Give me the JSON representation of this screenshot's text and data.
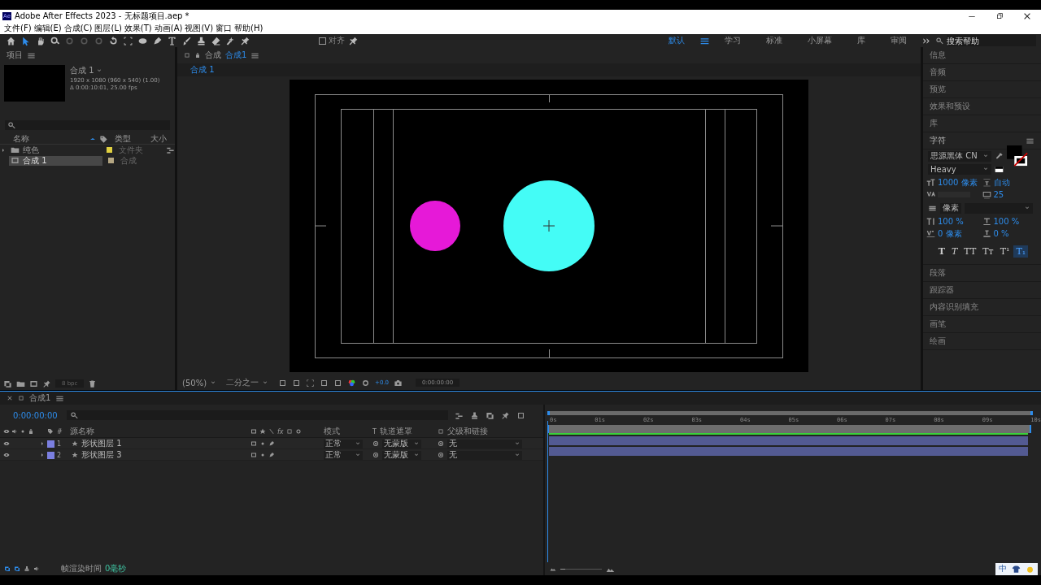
{
  "window": {
    "badge": "Ae",
    "title": "Adobe After Effects 2023 - 无标题项目.aep *"
  },
  "menu": [
    "文件(F)",
    "编辑(E)",
    "合成(C)",
    "图层(L)",
    "效果(T)",
    "动画(A)",
    "视图(V)",
    "窗口",
    "帮助(H)"
  ],
  "tools": [
    {
      "kind": "home",
      "selected": false,
      "disabled": false
    },
    {
      "kind": "select",
      "selected": true,
      "disabled": false
    },
    {
      "kind": "hand",
      "selected": false,
      "disabled": false
    },
    {
      "kind": "zoom",
      "selected": false,
      "disabled": false
    },
    {
      "kind": "orbit",
      "selected": false,
      "disabled": true
    },
    {
      "kind": "orbit",
      "selected": false,
      "disabled": true
    },
    {
      "kind": "orbit",
      "selected": false,
      "disabled": true
    },
    {
      "kind": "rotate",
      "selected": false,
      "disabled": false
    },
    {
      "kind": "marquee",
      "selected": false,
      "disabled": false
    },
    {
      "kind": "ellipse",
      "selected": false,
      "disabled": false
    },
    {
      "kind": "pen",
      "selected": false,
      "disabled": false
    },
    {
      "kind": "text",
      "selected": false,
      "disabled": false
    },
    {
      "kind": "brush",
      "selected": false,
      "disabled": false
    },
    {
      "kind": "stamp",
      "selected": false,
      "disabled": false
    },
    {
      "kind": "eraser",
      "selected": false,
      "disabled": false
    },
    {
      "kind": "roto",
      "selected": false,
      "disabled": false
    },
    {
      "kind": "pin",
      "selected": false,
      "disabled": false
    }
  ],
  "snap": {
    "label": "对齐",
    "checked": false
  },
  "workspaces": [
    {
      "label": "默认",
      "selected": true
    },
    {
      "label": "学习",
      "selected": false
    },
    {
      "label": "标准",
      "selected": false
    },
    {
      "label": "小屏幕",
      "selected": false
    },
    {
      "label": "库",
      "selected": false
    },
    {
      "label": "审阅",
      "selected": false
    }
  ],
  "search": {
    "placeholder": "搜索帮助"
  },
  "project": {
    "title": "项目",
    "comp_name": "合成 1",
    "comp_size": "1920 x 1080  (960 x 540) (1.00)",
    "comp_duration": "Δ 0:00:10:01, 25.00 fps",
    "columns": [
      "名称",
      "类型",
      "大小"
    ],
    "rows": [
      {
        "kind": "folder",
        "name": "纯色",
        "type": "文件夹",
        "color": "#e0d040",
        "selected": false
      },
      {
        "kind": "comp",
        "name": "合成 1",
        "type": "合成",
        "color": "#b4a682",
        "selected": true
      }
    ],
    "bpc": "8 bpc"
  },
  "viewer": {
    "panel": "合成",
    "tab": "合成1",
    "breadcrumb": "合成 1",
    "shapes": [
      {
        "kind": "small",
        "color": "#e619d8"
      },
      {
        "kind": "large",
        "color": "#44fcf6"
      }
    ],
    "zoom": "(50%)",
    "resolution": "二分之一",
    "exposure": "+0.0",
    "timecode": "0:00:00:00"
  },
  "panels_top": [
    "信息",
    "音频",
    "预览",
    "效果和预设",
    "库"
  ],
  "character": {
    "title": "字符",
    "font": "思源黑体 CN",
    "style": "Heavy",
    "metrics": [
      {
        "kind": "size",
        "value": "1000 像素"
      },
      {
        "kind": "leading",
        "value": "自动"
      },
      {
        "kind": "kerning"
      },
      {
        "kind": "tracking",
        "value": "25"
      }
    ],
    "stroke": "像素",
    "scales": [
      {
        "kind": "vscale",
        "value": "100 %"
      },
      {
        "kind": "hscale",
        "value": "100 %"
      },
      {
        "kind": "baseline",
        "value": "0 像素"
      },
      {
        "kind": "tsume",
        "value": "0 %"
      }
    ],
    "styles": [
      {
        "kind": "bold",
        "label": "T",
        "selected": false
      },
      {
        "kind": "italic",
        "label": "T",
        "selected": false
      },
      {
        "kind": "caps",
        "label": "TT",
        "selected": false
      },
      {
        "kind": "smallcaps",
        "label": "Tт",
        "selected": false
      },
      {
        "kind": "super",
        "label": "T¹",
        "selected": false
      },
      {
        "kind": "sub",
        "label": "T₁",
        "selected": true
      }
    ]
  },
  "panels_bottom": [
    "段落",
    "跟踪器",
    "内容识别填充",
    "画笔",
    "绘画"
  ],
  "timeline": {
    "tab": "合成1",
    "timecode": "0:00:00:00",
    "columns": {
      "number": "#",
      "source": "源名称",
      "fx": "fx",
      "mode": "模式",
      "t": "T",
      "matte": "轨道遮罩",
      "parent": "父级和链接"
    },
    "layers": [
      {
        "number": "1",
        "name": "形状图层 1",
        "mode": "正常",
        "matte": "无蒙版",
        "parent": "无",
        "color": "#7b7fe0"
      },
      {
        "number": "2",
        "name": "形状图层 3",
        "mode": "正常",
        "matte": "无蒙版",
        "parent": "无",
        "color": "#7b7fe0"
      }
    ],
    "ticks": [
      "0s",
      "01s",
      "02s",
      "03s",
      "04s",
      "05s",
      "06s",
      "07s",
      "08s",
      "09s",
      "10s"
    ],
    "render_label": "帧渲染时间",
    "render_time": "0毫秒"
  },
  "ime": {
    "label": "中"
  }
}
